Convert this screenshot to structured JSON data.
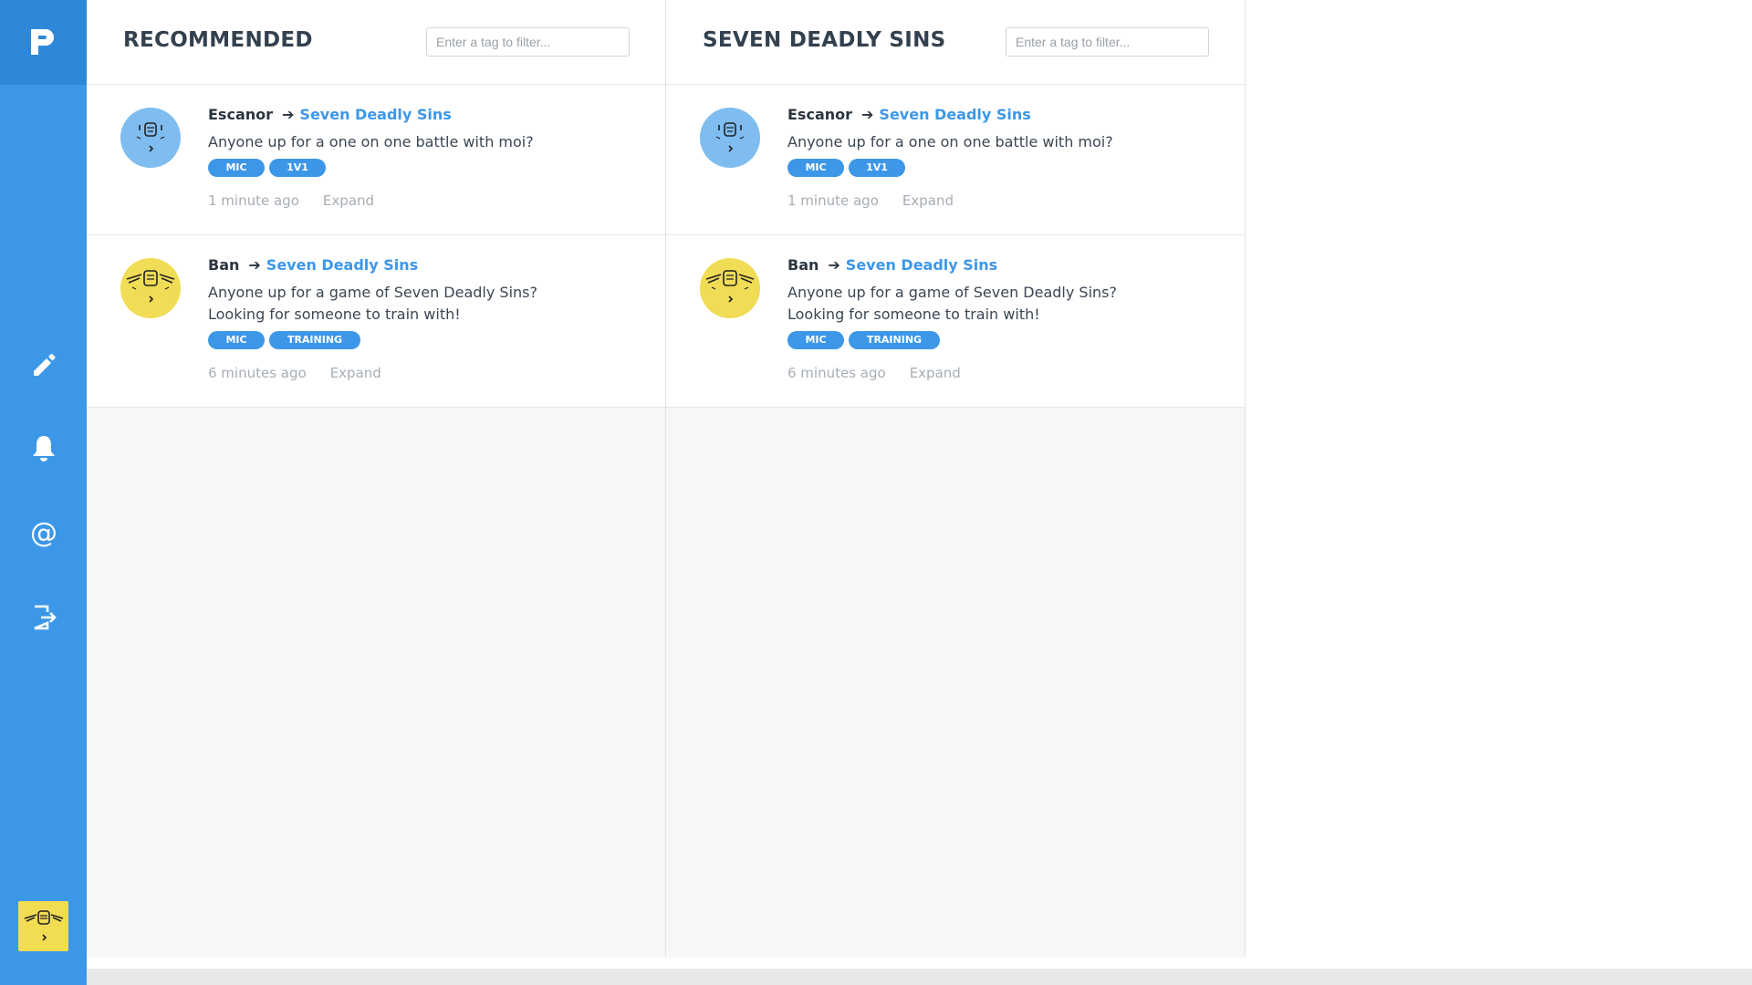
{
  "sidebar": {
    "logo": "P",
    "nav": [
      {
        "name": "compose",
        "icon": "pencil-icon"
      },
      {
        "name": "notifications",
        "icon": "bell-icon"
      },
      {
        "name": "mentions",
        "icon": "at-icon"
      },
      {
        "name": "logout",
        "icon": "logout-icon"
      }
    ],
    "colors": {
      "sidebar": "#3d97e8",
      "logo_bg": "#2e88da",
      "user_avatar": "#f2dc52"
    }
  },
  "columns": [
    {
      "title": "RECOMMENDED",
      "filter_placeholder": "Enter a tag to filter...",
      "posts": [
        {
          "author": "Escanor",
          "group": "Seven Deadly Sins",
          "message": "Anyone up for a one on one battle with moi?",
          "tags": [
            "MIC",
            "1V1"
          ],
          "time": "1 minute ago",
          "expand": "Expand"
        },
        {
          "author": "Ban",
          "group": "Seven Deadly Sins",
          "message": "Anyone up for a game of Seven Deadly Sins? Looking for someone to train with!",
          "tags": [
            "MIC",
            "TRAINING"
          ],
          "time": "6 minutes ago",
          "expand": "Expand"
        }
      ]
    },
    {
      "title": "SEVEN DEADLY SINS",
      "filter_placeholder": "Enter a tag to filter...",
      "posts": [
        {
          "author": "Escanor",
          "group": "Seven Deadly Sins",
          "message": "Anyone up for a one on one battle with moi?",
          "tags": [
            "MIC",
            "1V1"
          ],
          "time": "1 minute ago",
          "expand": "Expand"
        },
        {
          "author": "Ban",
          "group": "Seven Deadly Sins",
          "message": "Anyone up for a game of Seven Deadly Sins? Looking for someone to train with!",
          "tags": [
            "MIC",
            "TRAINING"
          ],
          "time": "6 minutes ago",
          "expand": "Expand"
        }
      ]
    }
  ],
  "arrow_symbol": "➔"
}
